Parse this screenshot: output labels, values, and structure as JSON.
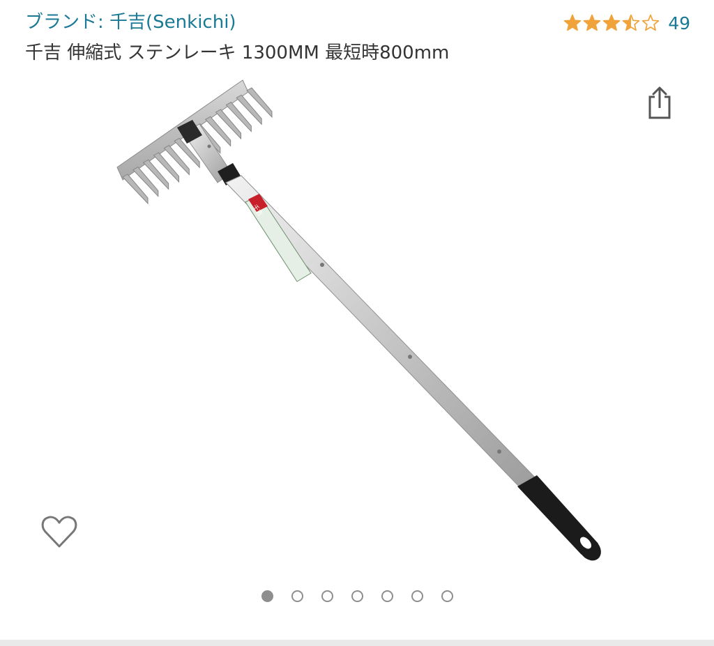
{
  "header": {
    "brand_link": "ブランド: 千吉(Senkichi)",
    "rating": {
      "stars": 3.5,
      "out_of": 5,
      "count": "49",
      "star_color": "#f0a33a"
    },
    "product_title": "千吉 伸縮式 ステンレーキ 1300MM 最短時800mm"
  },
  "image": {
    "alt": "千吉 伸縮式 ステンレーキ",
    "label_badge": "千吉"
  },
  "carousel": {
    "count": 7,
    "active_index": 0
  },
  "icons": {
    "share": "share-icon",
    "wishlist": "heart-icon"
  },
  "colors": {
    "link": "#1a7a96",
    "text": "#333333",
    "dot": "#8e8e8e",
    "divider": "#e9e9e9"
  }
}
